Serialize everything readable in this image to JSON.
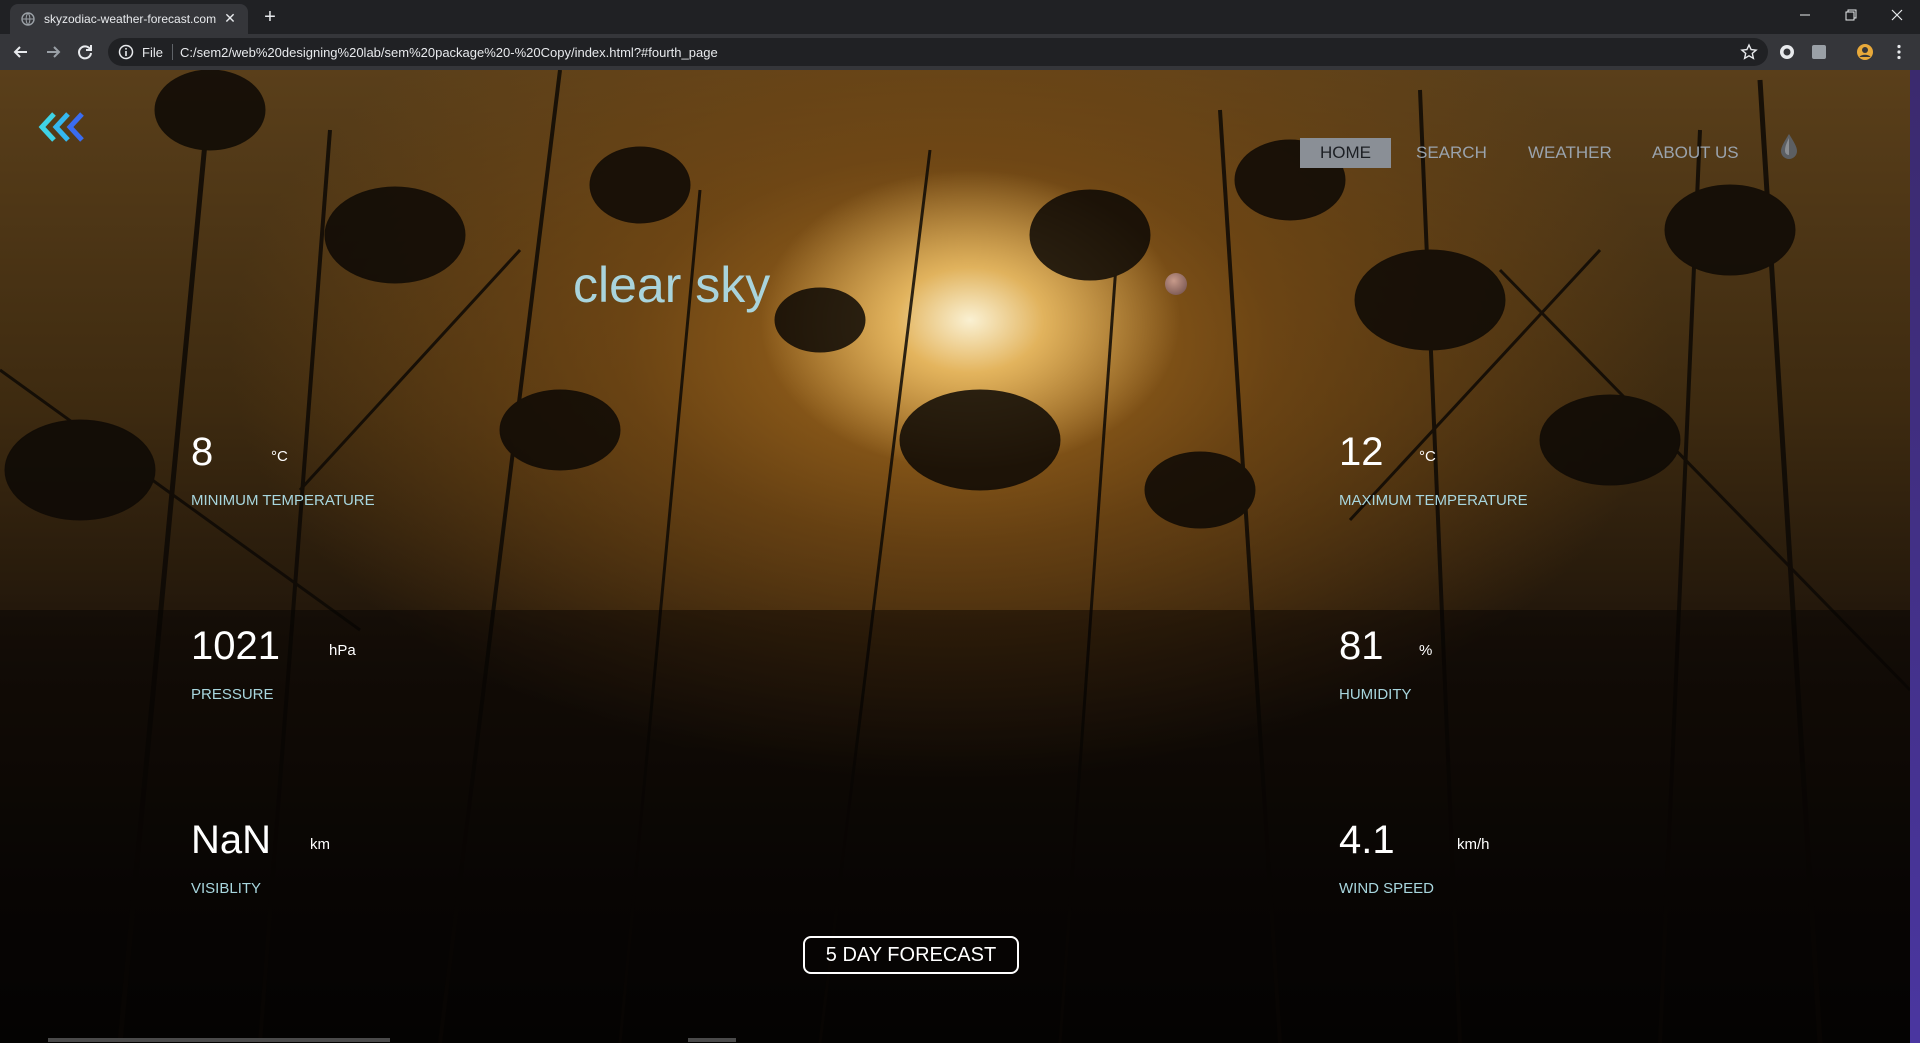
{
  "browser": {
    "tab_title": "skyzodiac-weather-forecast.com",
    "url_scheme": "File",
    "url": "C:/sem2/web%20designing%20lab/sem%20package%20-%20Copy/index.html?#fourth_page"
  },
  "nav": {
    "items": [
      {
        "label": "HOME",
        "active": true
      },
      {
        "label": "SEARCH",
        "active": false
      },
      {
        "label": "WEATHER",
        "active": false
      },
      {
        "label": "ABOUT US",
        "active": false
      }
    ]
  },
  "weather": {
    "description": "clear sky",
    "min_temp": {
      "value": "8",
      "unit": "°C",
      "label": "MINIMUM TEMPERATURE"
    },
    "max_temp": {
      "value": "12",
      "unit": "°C",
      "label": "MAXIMUM TEMPERATURE"
    },
    "pressure": {
      "value": "1021",
      "unit": "hPa",
      "label": "PRESSURE"
    },
    "humidity": {
      "value": "81",
      "unit": "%",
      "label": "HUMIDITY"
    },
    "visibility": {
      "value": "NaN",
      "unit": "km",
      "label": "VISIBLITY"
    },
    "wind": {
      "value": "4.1",
      "unit": "km/h",
      "label": "WIND SPEED"
    }
  },
  "forecast_button": {
    "label": "5 DAY FORECAST"
  },
  "colors": {
    "accent_text": "#a8d6de",
    "nav_active_bg": "#8a8f96",
    "logo_cyan": "#3fd3e6",
    "logo_blue": "#3a6cf0"
  },
  "icons": {
    "logo": "triple-chevron-left-logo",
    "theme": "drop-icon"
  }
}
